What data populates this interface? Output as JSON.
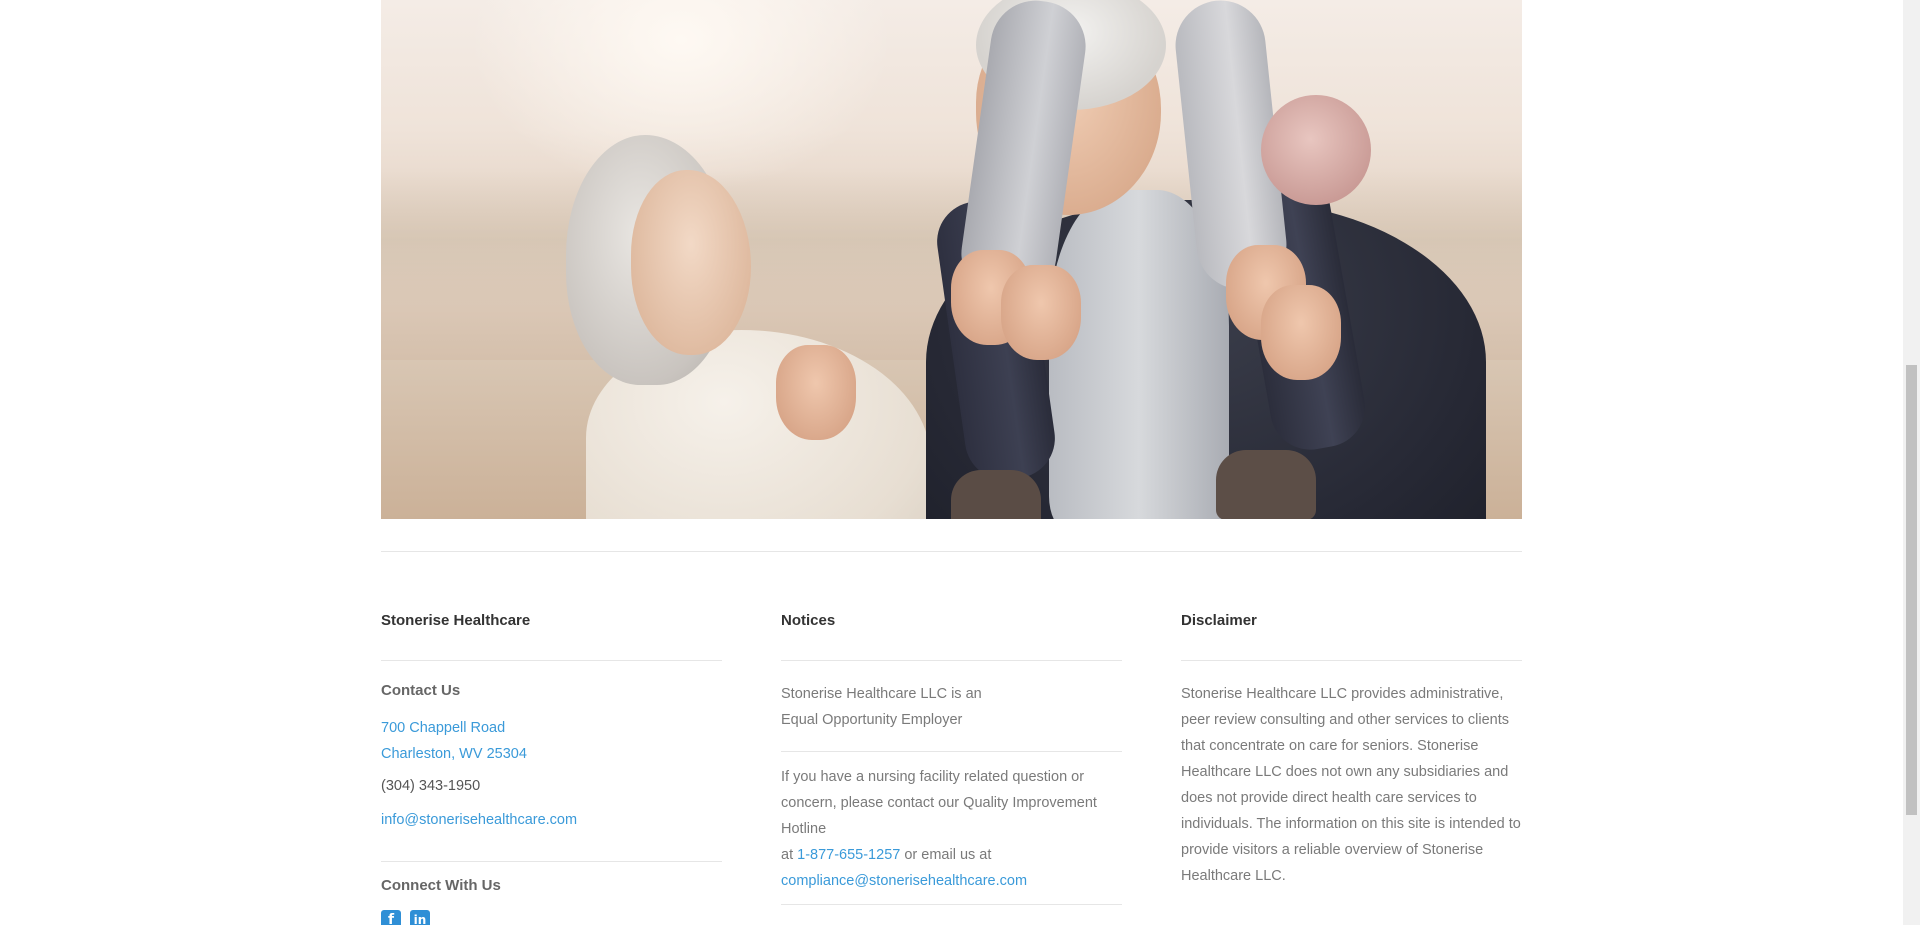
{
  "hero": {
    "alt": "Senior couple laughing outdoors with a child on the man's shoulders"
  },
  "footer": {
    "col1": {
      "title": "Stonerise Healthcare",
      "contact_title": "Contact Us",
      "address_line1": "700 Chappell Road",
      "address_line2": "Charleston, WV 25304",
      "phone": "(304) 343-1950",
      "email": "info@stonerisehealthcare.com",
      "connect_title": "Connect With Us",
      "social": [
        {
          "name": "facebook",
          "glyph": "f"
        },
        {
          "name": "linkedin",
          "glyph": "in"
        }
      ]
    },
    "col2": {
      "title": "Notices",
      "notice1_line1": "Stonerise Healthcare LLC is an",
      "notice1_line2": "Equal Opportunity Employer",
      "notice2_text": "If you have a nursing facility related question or concern, please contact our Quality Improvement Hotline",
      "notice2_at": "at ",
      "hotline": "1-877-655-1257",
      "notice2_mid": " or email us at",
      "compliance_email": "compliance@stonerisehealthcare.com"
    },
    "col3": {
      "title": "Disclaimer",
      "text": "Stonerise Healthcare LLC provides administrative, peer review consulting and other services to clients that concentrate on care for seniors. Stonerise Healthcare LLC does not own any subsidiaries and does not provide direct health care services to individuals. The information on this site is intended to provide visitors a reliable overview of Stonerise Healthcare LLC."
    }
  },
  "colors": {
    "link": "#3a9ad9",
    "social": "#2f8fd6",
    "heading": "#333333",
    "text": "#7a7a7a"
  }
}
